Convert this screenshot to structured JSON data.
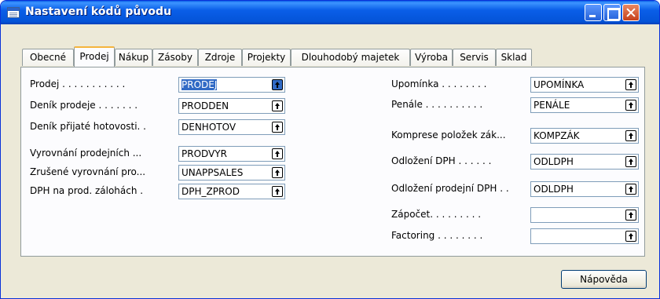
{
  "window": {
    "title": "Nastavení kódů původu"
  },
  "tabs": [
    {
      "label": "Obecné"
    },
    {
      "label": "Prodej",
      "active": true
    },
    {
      "label": "Nákup"
    },
    {
      "label": "Zásoby"
    },
    {
      "label": "Zdroje"
    },
    {
      "label": "Projekty"
    },
    {
      "label": "Dlouhodobý majetek"
    },
    {
      "label": "Výroba"
    },
    {
      "label": "Servis"
    },
    {
      "label": "Sklad"
    }
  ],
  "left_fields": [
    {
      "label": "Prodej . . . . . . . . . . .",
      "value": "PRODEJ",
      "selected": true
    },
    {
      "label": "Deník prodeje . . . . . . .",
      "value": "PRODDEN"
    },
    {
      "label": "Deník přijaté hotovosti. .",
      "value": "DENHOTOV"
    },
    {
      "label": "Vyrovnání prodejních ...",
      "value": "PRODVYR"
    },
    {
      "label": "Zrušené vyrovnání pro...",
      "value": "UNAPPSALES"
    },
    {
      "label": "DPH na prod. zálohách .",
      "value": "DPH_ZPROD"
    }
  ],
  "right_fields": [
    {
      "label": "Upomínka . . . . . . . .",
      "value": "UPOMÍNKA"
    },
    {
      "label": "Penále . . . . . . . . . .",
      "value": "PENÁLE"
    },
    {
      "label": "Komprese položek zák...",
      "value": "KOMPZÁK"
    },
    {
      "label": "Odložení DPH . . . . . .",
      "value": "ODLDPH"
    },
    {
      "label": "Odložení prodejní DPH . .",
      "value": "ODLDPH"
    },
    {
      "label": "Zápočet. . . . . . . . .",
      "value": ""
    },
    {
      "label": "Factoring . . . . . . . .",
      "value": ""
    }
  ],
  "buttons": {
    "help": "Nápověda"
  },
  "icons": {
    "lookup": "lookup-arrow-icon",
    "window": "form-icon"
  },
  "colors": {
    "titlebar": "#0454d8",
    "selection": "#316ac5",
    "tab_highlight": "#f5b43d"
  }
}
